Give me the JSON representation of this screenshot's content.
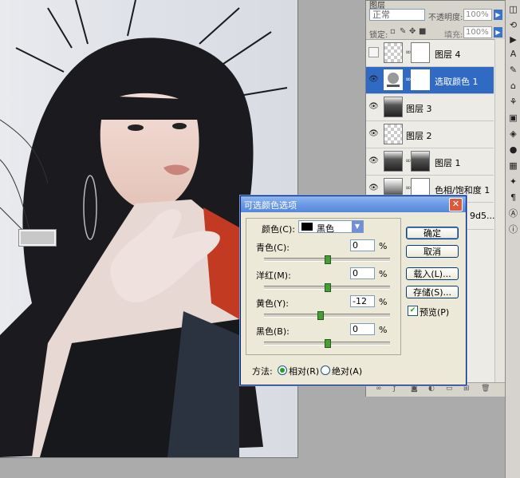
{
  "layers_panel": {
    "tab_title": "图层",
    "blend_mode": "正常",
    "opacity_label": "不透明度:",
    "opacity_value": "100%",
    "lock_label": "锁定:",
    "fill_label": "填充:",
    "fill_value": "100%",
    "layers": [
      {
        "name": "图层 4",
        "visible": false,
        "thumb": "checker",
        "mask": "white",
        "selected": false
      },
      {
        "name": "选取颜色 1",
        "visible": true,
        "thumb": "selective-color",
        "mask": "white",
        "selected": true
      },
      {
        "name": "图层 3",
        "visible": true,
        "thumb": "photo",
        "mask": null,
        "selected": false
      },
      {
        "name": "图层 2",
        "visible": true,
        "thumb": "checker",
        "mask": null,
        "selected": false
      },
      {
        "name": "图层 1",
        "visible": true,
        "thumb": "photo",
        "mask": "photo",
        "selected": false
      },
      {
        "name": "色相/饱和度 1",
        "visible": true,
        "thumb": "adjustment",
        "mask": "white",
        "selected": false
      },
      {
        "name": "9d5...",
        "visible": true,
        "thumb": "photo",
        "mask": null,
        "selected": false
      }
    ]
  },
  "dialog": {
    "title": "可选颜色选项",
    "color_label": "颜色(C):",
    "color_value": "黑色",
    "color_swatch": "#000000",
    "sliders": [
      {
        "label": "青色(C):",
        "value": "0",
        "unit": "%",
        "position": 0.5
      },
      {
        "label": "洋红(M):",
        "value": "0",
        "unit": "%",
        "position": 0.5
      },
      {
        "label": "黄色(Y):",
        "value": "-12",
        "unit": "%",
        "position": 0.44
      },
      {
        "label": "黑色(B):",
        "value": "0",
        "unit": "%",
        "position": 0.5
      }
    ],
    "buttons": {
      "ok": "确定",
      "cancel": "取消",
      "load": "载入(L)...",
      "save": "存储(S)..."
    },
    "preview_label": "预览(P)",
    "preview_checked": true,
    "method_label": "方法:",
    "relative_label": "相对(R)",
    "absolute_label": "绝对(A)",
    "method_selected": "relative"
  },
  "toolbar": {
    "items": [
      "history-icon",
      "paths-icon",
      "actions-icon",
      "type-icon",
      "brush-icon",
      "tool-presets-icon",
      "clone-icon",
      "layer-comps-icon",
      "layers-icon",
      "channels-icon",
      "swatches-icon",
      "styles-icon",
      "paragraph-icon",
      "character-icon",
      "info-icon"
    ]
  },
  "colors": {
    "selection_blue": "#316ac5",
    "dialog_bg": "#ece9d8",
    "title_blue": "#5787dc"
  }
}
